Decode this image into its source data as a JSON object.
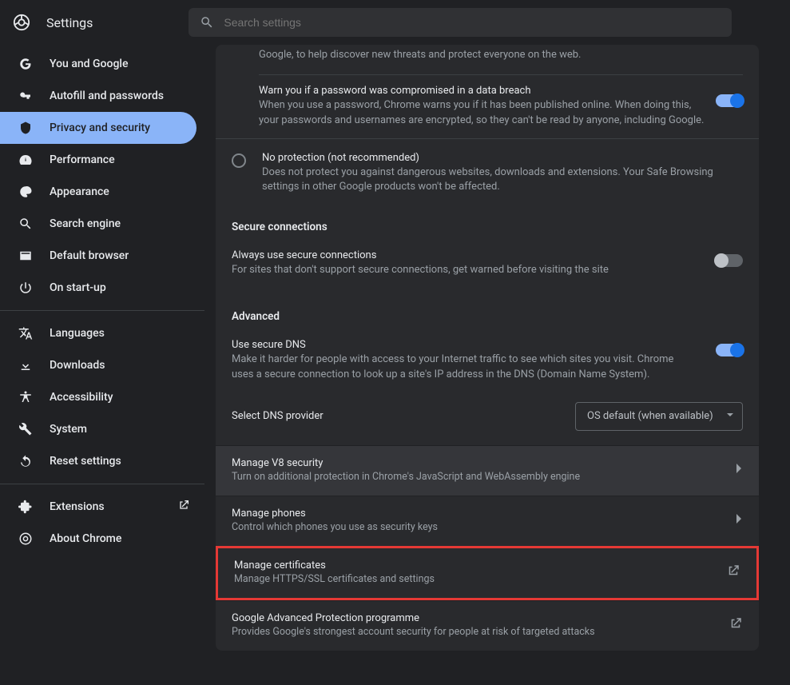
{
  "header": {
    "title": "Settings",
    "search_placeholder": "Search settings"
  },
  "sidebar": {
    "group1": [
      {
        "id": "you-google",
        "label": "You and Google"
      },
      {
        "id": "autofill",
        "label": "Autofill and passwords"
      },
      {
        "id": "privacy",
        "label": "Privacy and security",
        "active": true
      },
      {
        "id": "performance",
        "label": "Performance"
      },
      {
        "id": "appearance",
        "label": "Appearance"
      },
      {
        "id": "search-engine",
        "label": "Search engine"
      },
      {
        "id": "default-browser",
        "label": "Default browser"
      },
      {
        "id": "startup",
        "label": "On start-up"
      }
    ],
    "group2": [
      {
        "id": "languages",
        "label": "Languages"
      },
      {
        "id": "downloads",
        "label": "Downloads"
      },
      {
        "id": "accessibility",
        "label": "Accessibility"
      },
      {
        "id": "system",
        "label": "System"
      },
      {
        "id": "reset",
        "label": "Reset settings"
      }
    ],
    "group3": [
      {
        "id": "extensions",
        "label": "Extensions",
        "external": true
      },
      {
        "id": "about",
        "label": "About Chrome"
      }
    ]
  },
  "content": {
    "top_frag": "Google, to help discover new threats and protect everyone on the web.",
    "breach": {
      "title": "Warn you if a password was compromised in a data breach",
      "desc": "When you use a password, Chrome warns you if it has been published online. When doing this, your passwords and usernames are encrypted, so they can't be read by anyone, including Google.",
      "on": true
    },
    "noprotect": {
      "title": "No protection (not recommended)",
      "desc": "Does not protect you against dangerous websites, downloads and extensions. Your Safe Browsing settings in other Google products won't be affected."
    },
    "secure_h": "Secure connections",
    "secure": {
      "title": "Always use secure connections",
      "desc": "For sites that don't support secure connections, get warned before visiting the site",
      "on": false
    },
    "advanced_h": "Advanced",
    "dns": {
      "title": "Use secure DNS",
      "desc": "Make it harder for people with access to your Internet traffic to see which sites you visit. Chrome uses a secure connection to look up a site's IP address in the DNS (Domain Name System).",
      "on": true,
      "select_label": "Select DNS provider",
      "select_value": "OS default (when available)"
    },
    "nav": {
      "v8": {
        "title": "Manage V8 security",
        "desc": "Turn on additional protection in Chrome's JavaScript and WebAssembly engine"
      },
      "phones": {
        "title": "Manage phones",
        "desc": "Control which phones you use as security keys"
      },
      "certs": {
        "title": "Manage certificates",
        "desc": "Manage HTTPS/SSL certificates and settings"
      },
      "gap": {
        "title": "Google Advanced Protection programme",
        "desc": "Provides Google's strongest account security for people at risk of targeted attacks"
      }
    }
  }
}
